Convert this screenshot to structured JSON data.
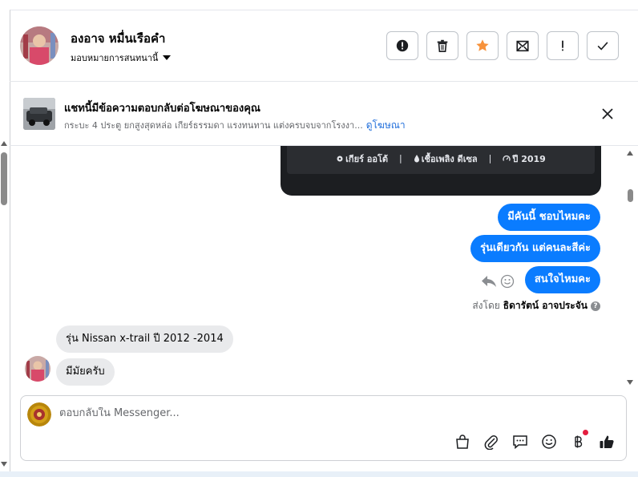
{
  "header": {
    "contact_name": "องอาจ หมื่นเรือคำ",
    "assign_label": "มอบหมายการสนทนานี้",
    "actions": [
      {
        "name": "mark-spam-button",
        "icon": "alert-circle-icon",
        "color": "#1c1e21"
      },
      {
        "name": "delete-button",
        "icon": "trash-icon",
        "color": "#1c1e21"
      },
      {
        "name": "follow-up-button",
        "icon": "star-icon",
        "color": "#f7923b"
      },
      {
        "name": "mark-unread-button",
        "icon": "envelope-icon",
        "color": "#1c1e21"
      },
      {
        "name": "mark-important-button",
        "icon": "exclamation-icon",
        "color": "#1c1e21"
      },
      {
        "name": "mark-done-button",
        "icon": "checkmark-icon",
        "color": "#1c1e21"
      }
    ]
  },
  "banner": {
    "title": "แชทนี้มีข้อความตอบกลับต่อโฆษณาของคุณ",
    "subtitle": "กระบะ 4 ประตู ยกสูงสุดหล่อ เกียร์ธรรมดา แรงทนทาน แต่งครบจบจากโรงงา...",
    "link": "ดูโฆษณา"
  },
  "chat": {
    "card_specs": {
      "transmission": "เกียร์ ออโต้",
      "fuel": "เชื้อเพลิง ดีเซล",
      "year": "ปี 2019"
    },
    "outgoing": [
      "มีคันนี้ ชอบไหมคะ",
      "รุ่นเดียวกัน แต่คนละสีค่ะ",
      "สนใจไหมคะ"
    ],
    "sent_by_prefix": "ส่งโดย",
    "sent_by_name": "ธิดารัตน์ อาจประจัน",
    "help_glyph": "?",
    "incoming": [
      "รุ่น Nissan  x-trail ปี 2012 -2014",
      "มีมัยครับ"
    ]
  },
  "composer": {
    "placeholder": "ตอบกลับใน Messenger...",
    "tools": [
      "shopping-bag-icon",
      "paperclip-icon",
      "saved-reply-icon",
      "emoji-icon",
      "baht-payment-icon",
      "like-icon"
    ],
    "accent": "#0a7cff"
  }
}
